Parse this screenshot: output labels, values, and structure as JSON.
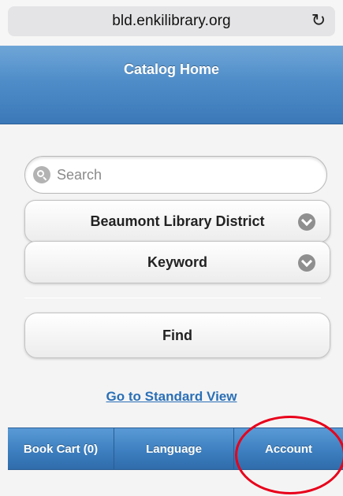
{
  "browser": {
    "url": "bld.enkilibrary.org",
    "reload_icon": "reload-icon"
  },
  "header": {
    "title": "Catalog Home"
  },
  "search": {
    "placeholder": "Search",
    "icon": "search-icon"
  },
  "selectors": {
    "library": "Beaumont Library District",
    "search_type": "Keyword",
    "icon": "chevron-down-icon"
  },
  "actions": {
    "find_label": "Find",
    "standard_view_label": "Go to Standard View"
  },
  "footer_nav": {
    "items": [
      {
        "label": "Book Cart (0)"
      },
      {
        "label": "Language"
      },
      {
        "label": "Account"
      }
    ]
  },
  "colors": {
    "header_blue": "#4f8dc9",
    "link_blue": "#2a6fb6",
    "annotation_red": "#e8001a"
  }
}
